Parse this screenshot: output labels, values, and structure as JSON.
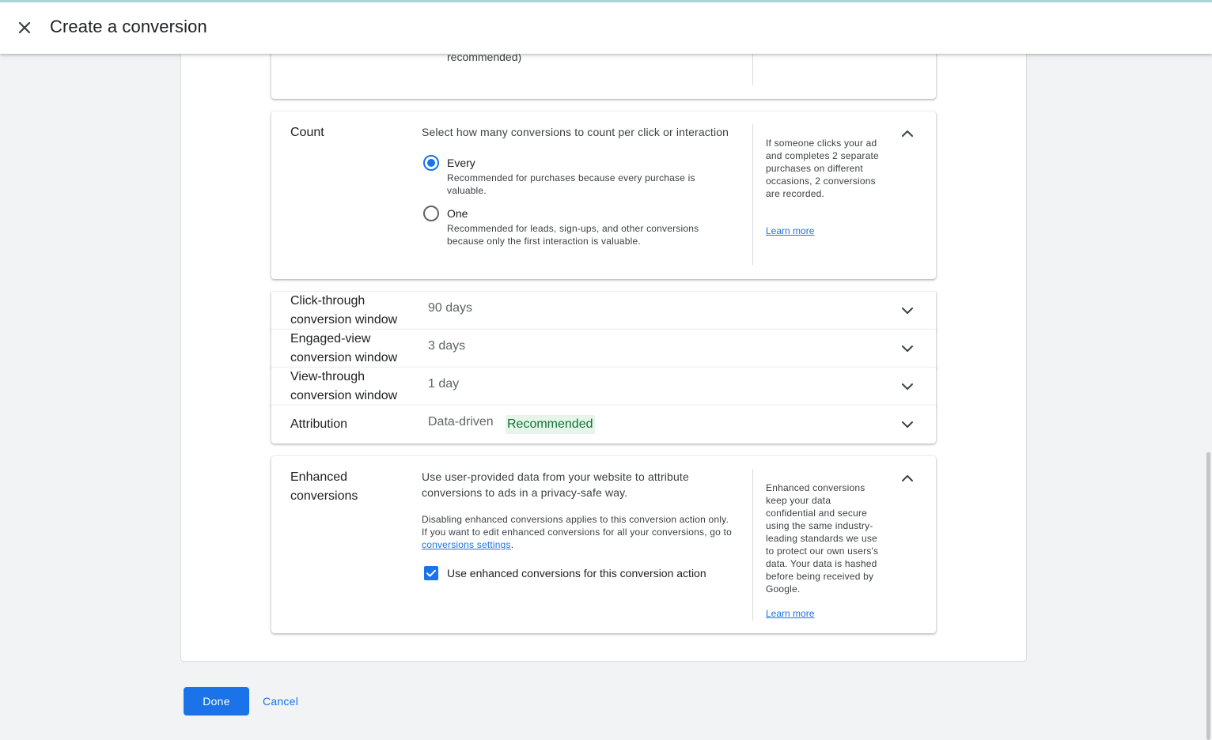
{
  "header": {
    "title": "Create a conversion",
    "close_icon": "close-icon"
  },
  "partial_card": {
    "text": "recommended)"
  },
  "count": {
    "label": "Count",
    "description": "Select how many conversions to count per click or interaction",
    "options": [
      {
        "title": "Every",
        "description": "Recommended for purchases because every purchase is valuable.",
        "selected": true
      },
      {
        "title": "One",
        "description": "Recommended for leads, sign-ups, and other conversions because only the first interaction is valuable.",
        "selected": false
      }
    ],
    "help": "If someone clicks your ad and completes 2 separate purchases on different occasions, 2 conversions are recorded.",
    "learn_more": "Learn more"
  },
  "rows": {
    "click_through": {
      "label_line1": "Click-through",
      "label_line2": "conversion window",
      "value": "90 days"
    },
    "engaged_view": {
      "label_line1": "Engaged-view",
      "label_line2": "conversion window",
      "value": "3 days"
    },
    "view_through": {
      "label_line1": "View-through",
      "label_line2": "conversion window",
      "value": "1 day"
    },
    "attribution": {
      "label": "Attribution",
      "value": "Data-driven",
      "badge": "Recommended"
    }
  },
  "enhanced": {
    "label_line1": "Enhanced",
    "label_line2": "conversions",
    "description_line1": "Use user-provided data from your website to attribute",
    "description_line2": "conversions to ads in a privacy-safe way.",
    "note_line1": "Disabling enhanced conversions applies to this conversion action only.",
    "note_line2": "If you want to edit enhanced conversions for all your conversions, go to",
    "note_link": "conversions settings",
    "note_end": ".",
    "checkbox_label": "Use enhanced conversions for this conversion action",
    "checkbox_checked": true,
    "help": "Enhanced conversions keep your data confidential and secure using the same industry-leading standards we use to protect our own users's data. Your data is hashed before being received by Google.",
    "learn_more": "Learn more"
  },
  "footer": {
    "done": "Done",
    "cancel": "Cancel"
  },
  "colors": {
    "accent": "#1a73e8",
    "badge_bg": "#e6f4ea",
    "badge_text": "#137333"
  }
}
